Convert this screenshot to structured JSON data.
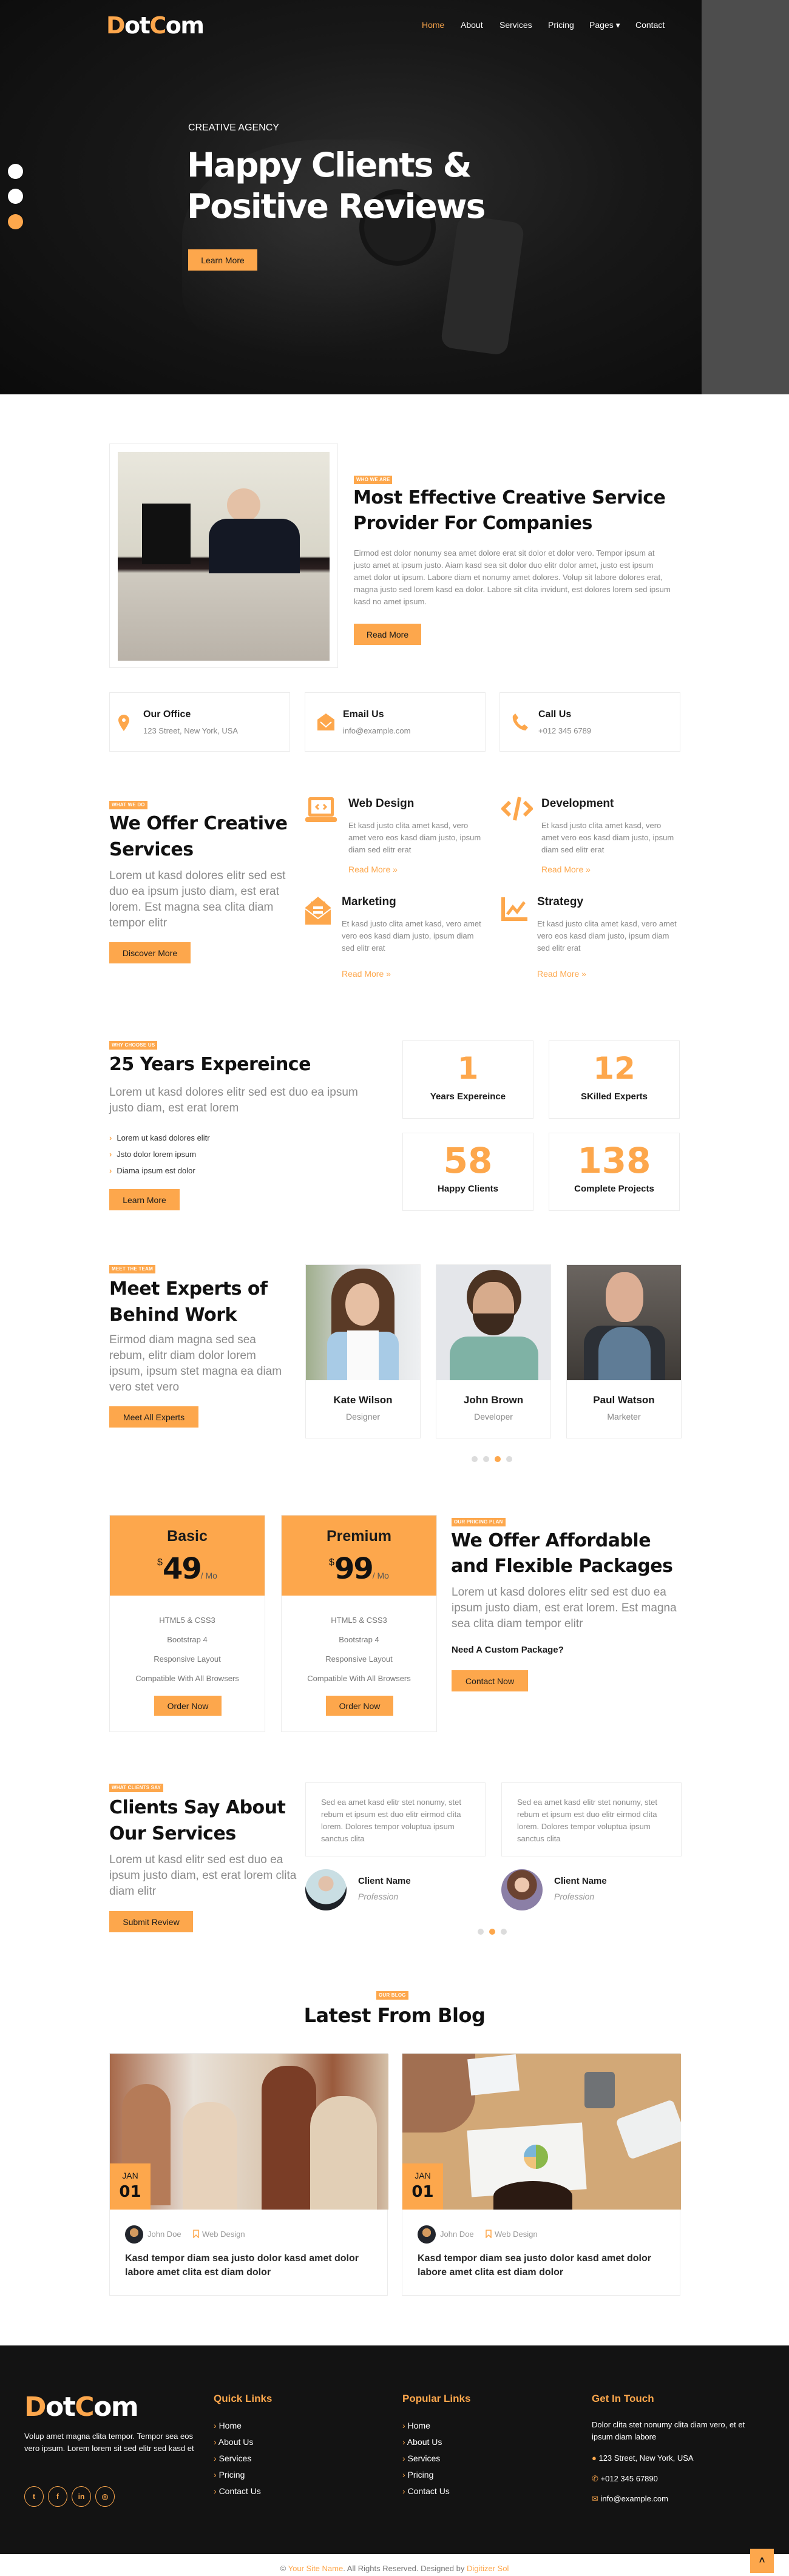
{
  "brand": {
    "logo_d": "D",
    "logo_ot": "ot",
    "logo_c": "C",
    "logo_om": "om",
    "accent": "#fda74c"
  },
  "nav": {
    "items": [
      {
        "label": "Home",
        "active": true
      },
      {
        "label": "About"
      },
      {
        "label": "Services"
      },
      {
        "label": "Pricing"
      },
      {
        "label": "Pages ▾"
      },
      {
        "label": "Contact"
      }
    ]
  },
  "hero": {
    "eyebrow": "CREATIVE AGENCY",
    "title_line1": "Happy Clients &",
    "title_line2": "Positive Reviews",
    "button": "Learn More",
    "slides": 3,
    "active_slide": 3
  },
  "about": {
    "tag": "WHO WE ARE",
    "title_line1": "Most Effective Creative Service",
    "title_line2": "Provider For Companies",
    "body": "Eirmod est dolor nonumy sea amet dolore erat sit dolor et dolor vero. Tempor ipsum at justo amet at ipsum justo. Aiam kasd sea sit dolor duo elitr dolor amet, justo est ipsum amet dolor ut ipsum. Labore diam et nonumy amet dolores. Volup sit labore dolores erat, magna justo sed lorem kasd ea dolor. Labore sit clita invidunt, est dolores lorem sed ipsum kasd no amet ipsum.",
    "button": "Read More"
  },
  "contact_cards": [
    {
      "icon": "map-marker-icon",
      "title": "Our Office",
      "value": "123 Street, New York, USA"
    },
    {
      "icon": "envelope-open-icon",
      "title": "Email Us",
      "value": "info@example.com"
    },
    {
      "icon": "phone-icon",
      "title": "Call Us",
      "value": "+012 345 6789"
    }
  ],
  "services": {
    "tag": "WHAT WE DO",
    "title_line1": "We Offer Creative",
    "title_line2": "Services",
    "lead": "Lorem ut kasd dolores elitr sed est duo ea ipsum justo diam, est erat lorem. Est magna sea clita diam tempor elitr",
    "button": "Discover More",
    "items": [
      {
        "icon": "laptop-code-icon",
        "title": "Web Design",
        "text": "Et kasd justo clita amet kasd, vero amet vero eos kasd diam justo, ipsum diam sed elitr erat",
        "link": "Read More »"
      },
      {
        "icon": "code-icon",
        "title": "Development",
        "text": "Et kasd justo clita amet kasd, vero amet vero eos kasd diam justo, ipsum diam sed elitr erat",
        "link": "Read More »"
      },
      {
        "icon": "envelope-open-text-icon",
        "title": "Marketing",
        "text": "Et kasd justo clita amet kasd, vero amet vero eos kasd diam justo, ipsum diam sed elitr erat",
        "link": "Read More »"
      },
      {
        "icon": "chart-line-icon",
        "title": "Strategy",
        "text": "Et kasd justo clita amet kasd, vero amet vero eos kasd diam justo, ipsum diam sed elitr erat",
        "link": "Read More »"
      }
    ]
  },
  "why": {
    "tag": "WHY CHOOSE US",
    "title": "25 Years Expereince",
    "lead": "Lorem ut kasd dolores elitr sed est duo ea ipsum justo diam, est erat lorem",
    "list": [
      "Lorem ut kasd dolores elitr",
      "Jsto dolor lorem ipsum",
      "Diama ipsum est dolor"
    ],
    "button": "Learn More",
    "stats": [
      {
        "value": "1",
        "label": "Years Expereince"
      },
      {
        "value": "12",
        "label": "SKilled Experts"
      },
      {
        "value": "58",
        "label": "Happy Clients"
      },
      {
        "value": "138",
        "label": "Complete Projects"
      }
    ]
  },
  "team": {
    "tag": "MEET THE TEAM",
    "title_line1": "Meet Experts of",
    "title_line2": "Behind Work",
    "lead": "Eirmod diam magna sed sea rebum, elitr diam dolor lorem ipsum, ipsum stet magna ea diam vero stet vero",
    "button": "Meet All Experts",
    "members": [
      {
        "name": "Kate Wilson",
        "role": "Designer"
      },
      {
        "name": "John Brown",
        "role": "Developer"
      },
      {
        "name": "Paul Watson",
        "role": "Marketer"
      }
    ],
    "pages": 4,
    "active_page": 3
  },
  "pricing": {
    "tag": "OUR PRICING PLAN",
    "title_line1": "We Offer Affordable",
    "title_line2": "and Flexible Packages",
    "lead": "Lorem ut kasd dolores elitr sed est duo ea ipsum justo diam, est erat lorem. Est magna sea clita diam tempor elitr",
    "custom": "Need A Custom Package?",
    "button": "Contact Now",
    "plans": [
      {
        "name": "Basic",
        "currency": "$",
        "price": "49",
        "period": "/ Mo",
        "features": [
          "HTML5 & CSS3",
          "Bootstrap 4",
          "Responsive Layout",
          "Compatible With All Browsers"
        ],
        "button": "Order Now"
      },
      {
        "name": "Premium",
        "currency": "$",
        "price": "99",
        "period": "/ Mo",
        "features": [
          "HTML5 & CSS3",
          "Bootstrap 4",
          "Responsive Layout",
          "Compatible With All Browsers"
        ],
        "button": "Order Now"
      }
    ]
  },
  "testimonials": {
    "tag": "WHAT CLIENTS SAY",
    "title_line1": "Clients Say About",
    "title_line2": "Our Services",
    "lead": "Lorem ut kasd elitr sed est duo ea ipsum justo diam, est erat lorem clita diam elitr",
    "button": "Submit Review",
    "items": [
      {
        "text": "Sed ea amet kasd elitr stet nonumy, stet rebum et ipsum est duo elitr eirmod clita lorem. Dolores tempor voluptua ipsum sanctus clita",
        "name": "Client Name",
        "profession": "Profession"
      },
      {
        "text": "Sed ea amet kasd elitr stet nonumy, stet rebum et ipsum est duo elitr eirmod clita lorem. Dolores tempor voluptua ipsum sanctus clita",
        "name": "Client Name",
        "profession": "Profession"
      }
    ],
    "pages": 3,
    "active_page": 2
  },
  "blog": {
    "tag": "OUR BLOG",
    "title": "Latest From Blog",
    "posts": [
      {
        "month": "JAN",
        "day": "01",
        "author": "John Doe",
        "category": "Web Design",
        "title": "Kasd tempor diam sea justo dolor kasd amet dolor labore amet clita est diam dolor"
      },
      {
        "month": "JAN",
        "day": "01",
        "author": "John Doe",
        "category": "Web Design",
        "title": "Kasd tempor diam sea justo dolor kasd amet dolor labore amet clita est diam dolor"
      }
    ]
  },
  "footer": {
    "about": "Volup amet magna clita tempor. Tempor sea eos vero ipsum. Lorem lorem sit sed elitr sed kasd et",
    "social": [
      {
        "icon": "twitter-icon",
        "glyph": "t"
      },
      {
        "icon": "facebook-icon",
        "glyph": "f"
      },
      {
        "icon": "linkedin-icon",
        "glyph": "in"
      },
      {
        "icon": "instagram-icon",
        "glyph": "◎"
      }
    ],
    "quick_title": "Quick Links",
    "quick": [
      "Home",
      "About Us",
      "Services",
      "Pricing",
      "Contact Us"
    ],
    "popular_title": "Popular Links",
    "popular": [
      "Home",
      "About Us",
      "Services",
      "Pricing",
      "Contact Us"
    ],
    "touch_title": "Get In Touch",
    "touch_text": "Dolor clita stet nonumy clita diam vero, et et ipsum diam labore",
    "address": "123 Street, New York, USA",
    "phone": "+012 345 67890",
    "email": "info@example.com"
  },
  "copyright": {
    "prefix": "© ",
    "site": "Your Site Name",
    "middle": ". All Rights Reserved. Designed by ",
    "designer": "Digitizer Sol"
  },
  "back_to_top": "˄"
}
